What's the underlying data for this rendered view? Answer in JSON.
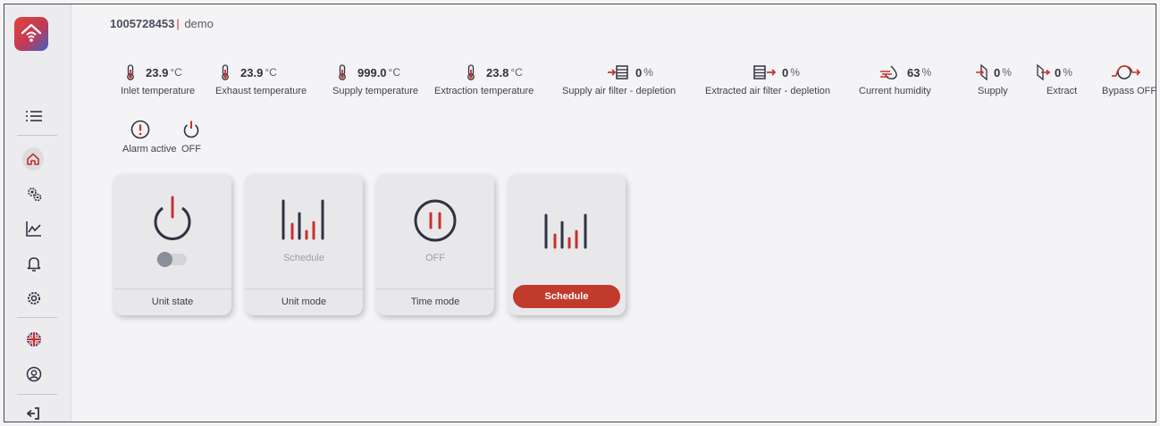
{
  "header": {
    "device_id": "1005728453",
    "separator": "|",
    "user": "demo"
  },
  "sensors": [
    {
      "icon": "thermometer-icon",
      "value": "23.9",
      "unit": "°C",
      "label": "Inlet temperature"
    },
    {
      "icon": "thermometer-icon",
      "value": "23.9",
      "unit": "°C",
      "label": "Exhaust temperature"
    },
    {
      "icon": "thermometer-icon",
      "value": "999.0",
      "unit": "°C",
      "label": "Supply temperature"
    },
    {
      "icon": "thermometer-icon",
      "value": "23.8",
      "unit": "°C",
      "label": "Extraction temperature"
    },
    {
      "icon": "supply-filter-icon",
      "value": "0",
      "unit": "%",
      "label": "Supply air filter - depletion"
    },
    {
      "icon": "extract-filter-icon",
      "value": "0",
      "unit": "%",
      "label": "Extracted air filter - depletion"
    },
    {
      "icon": "humidity-icon",
      "value": "63",
      "unit": "%",
      "label": "Current humidity"
    },
    {
      "icon": "supply-fan-icon",
      "value": "0",
      "unit": "%",
      "label": "Supply"
    },
    {
      "icon": "extract-fan-icon",
      "value": "0",
      "unit": "%",
      "label": "Extract"
    },
    {
      "icon": "bypass-icon",
      "label": "Bypass OFF"
    }
  ],
  "status": [
    {
      "icon": "alarm-icon",
      "label": "Alarm active"
    },
    {
      "icon": "power-icon",
      "label": "OFF"
    }
  ],
  "cards": [
    {
      "caption": "Unit state",
      "toggle_on": false
    },
    {
      "caption": "Unit mode",
      "sub": "Schedule"
    },
    {
      "caption": "Time mode",
      "sub": "OFF"
    },
    {
      "button": "Schedule"
    }
  ],
  "sidebar": {
    "items": [
      "menu-icon",
      "home-icon",
      "gears-icon",
      "chart-icon",
      "bell-icon",
      "settings-icon",
      "uk-flag-icon",
      "support-icon",
      "logout-icon"
    ],
    "active": "home-icon"
  },
  "colors": {
    "accent": "#c9302c",
    "dark": "#2f3340",
    "background": "#f4f4f6"
  }
}
